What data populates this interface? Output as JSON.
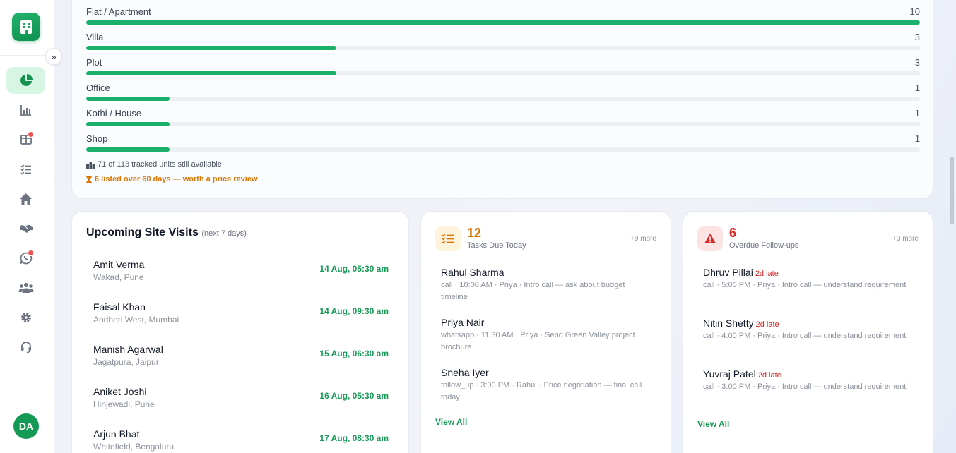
{
  "sidebar": {
    "collapse_icon": "»",
    "avatar_initials": "DA",
    "nav": [
      {
        "icon": "pie-chart-icon",
        "active": true
      },
      {
        "icon": "bar-chart-icon"
      },
      {
        "icon": "grid-icon",
        "badge": true
      },
      {
        "icon": "task-list-icon"
      },
      {
        "icon": "home-icon"
      },
      {
        "icon": "handshake-icon"
      },
      {
        "icon": "whatsapp-icon",
        "badge": true
      },
      {
        "icon": "users-icon"
      },
      {
        "icon": "gear-icon"
      },
      {
        "icon": "headset-icon"
      }
    ]
  },
  "property_types": {
    "max": 10,
    "rows": [
      {
        "label": "Flat / Apartment",
        "count": "10",
        "value": 10
      },
      {
        "label": "Villa",
        "count": "3",
        "value": 3
      },
      {
        "label": "Plot",
        "count": "3",
        "value": 3
      },
      {
        "label": "Office",
        "count": "1",
        "value": 1
      },
      {
        "label": "Kothi / House",
        "count": "1",
        "value": 1
      },
      {
        "label": "Shop",
        "count": "1",
        "value": 1
      }
    ],
    "available_text": "71 of 113 tracked units still available",
    "review_text": "6 listed over 60 days — worth a price review"
  },
  "visits": {
    "title": "Upcoming Site Visits",
    "subtitle": "(next 7 days)",
    "items": [
      {
        "name": "Amit Verma",
        "location": "Wakad, Pune",
        "when": "14 Aug, 05:30 am"
      },
      {
        "name": "Faisal Khan",
        "location": "Andheri West, Mumbai",
        "when": "14 Aug, 09:30 am"
      },
      {
        "name": "Manish Agarwal",
        "location": "Jagatpura, Jaipur",
        "when": "15 Aug, 06:30 am"
      },
      {
        "name": "Aniket Joshi",
        "location": "Hinjewadi, Pune",
        "when": "16 Aug, 05:30 am"
      },
      {
        "name": "Arjun Bhat",
        "location": "Whitefield, Bengaluru",
        "when": "17 Aug, 08:30 am"
      }
    ]
  },
  "tasks": {
    "count": "12",
    "label": "Tasks Due Today",
    "more": "+9 more",
    "color": "#d97706",
    "items": [
      {
        "name": "Rahul Sharma",
        "desc": "call · 10:00 AM · Priya · Intro call — ask about budget timeline"
      },
      {
        "name": "Priya Nair",
        "desc": "whatsapp · 11:30 AM · Priya · Send Green Valley project brochure"
      },
      {
        "name": "Sneha Iyer",
        "desc": "follow_up · 3:00 PM · Rahul · Price negotiation — final call today"
      }
    ],
    "view_all": "View All"
  },
  "followups": {
    "count": "6",
    "label": "Overdue Follow-ups",
    "more": "+3 more",
    "color": "#dc2626",
    "items": [
      {
        "name": "Dhruv Pillai",
        "late": "2d late",
        "desc": "call · 5:00 PM · Priya · Intro call — understand requirement"
      },
      {
        "name": "Nitin Shetty",
        "late": "2d late",
        "desc": "call · 4:00 PM · Priya · Intro call — understand requirement"
      },
      {
        "name": "Yuvraj Patel",
        "late": "2d late",
        "desc": "call · 3:00 PM · Priya · Intro call — understand requirement"
      }
    ],
    "view_all": "View All"
  }
}
